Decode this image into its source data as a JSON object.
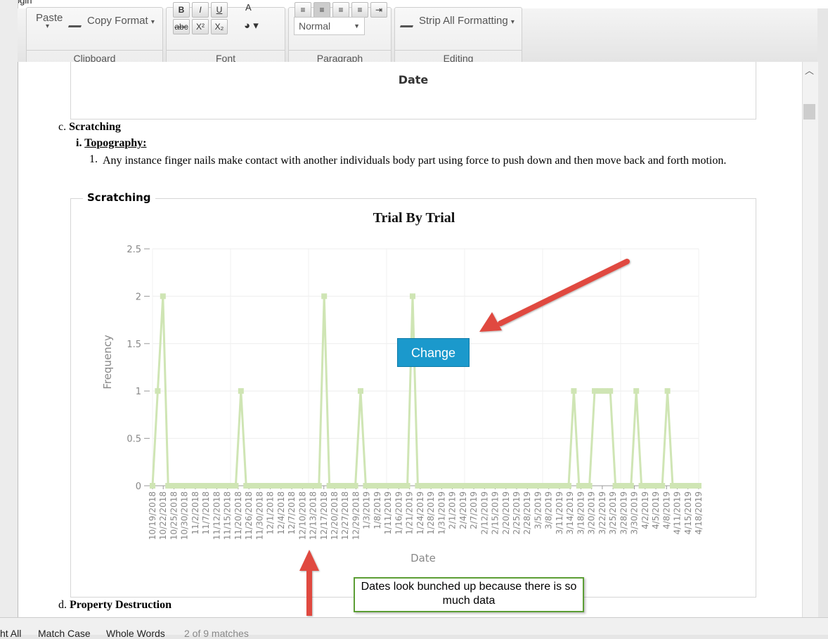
{
  "top": {
    "text": "ıl, Login"
  },
  "ribbon": {
    "groups": [
      {
        "label": "Clipboard"
      },
      {
        "label": "Font"
      },
      {
        "label": "Paragraph"
      },
      {
        "label": "Editing"
      }
    ],
    "paste_label": "Paste",
    "copy_format_label": "Copy Format",
    "paragraph_style": "Normal",
    "strip_formatting_label": "Strip All Formatting",
    "font_buttons": [
      "B",
      "I",
      "U",
      "abc",
      "X²",
      "X₂"
    ]
  },
  "doc": {
    "top_chart_xlabel": "Date",
    "section_c_marker": "c.",
    "section_c_title": "Scratching",
    "sub_i_marker": "i.",
    "sub_i_title": "Topography:",
    "item_1_marker": "1.",
    "item_1_text": "Any instance finger nails make contact with another individuals body part using force to push down and then move back and forth motion.",
    "chart_frame_label": "Scratching",
    "section_d_marker": "d.",
    "section_d_title": "Property Destruction"
  },
  "chart_data": {
    "type": "line",
    "title": "Trial By Trial",
    "xlabel": "Date",
    "ylabel": "Frequency",
    "ylim": [
      0,
      2.5
    ],
    "yticks": [
      0,
      0.5,
      1,
      1.5,
      2,
      2.5
    ],
    "xtick_labels": [
      "10/19/2018",
      "10/22/2018",
      "10/25/2018",
      "10/30/2018",
      "11/2/2018",
      "11/7/2018",
      "11/12/2018",
      "11/15/2018",
      "11/20/2018",
      "11/26/2018",
      "11/30/2018",
      "12/1/2018",
      "12/4/2018",
      "12/7/2018",
      "12/10/2018",
      "12/13/2018",
      "12/17/2018",
      "12/20/2018",
      "12/27/2018",
      "12/29/2018",
      "1/3/2019",
      "1/8/2019",
      "1/11/2019",
      "1/16/2019",
      "1/21/2019",
      "1/24/2019",
      "1/28/2019",
      "1/31/2019",
      "2/1/2019",
      "2/4/2019",
      "2/7/2019",
      "2/12/2019",
      "2/15/2019",
      "2/20/2019",
      "2/25/2019",
      "2/28/2019",
      "3/5/2019",
      "3/8/2019",
      "3/11/2019",
      "3/14/2019",
      "3/18/2019",
      "3/20/2019",
      "3/22/2019",
      "3/25/2019",
      "3/28/2019",
      "3/30/2019",
      "4/2/2019",
      "4/5/2019",
      "4/8/2019",
      "4/11/2019",
      "4/15/2019",
      "4/18/2019"
    ],
    "series": [
      {
        "values": [
          0,
          1,
          2,
          0,
          0,
          0,
          0,
          0,
          0,
          0,
          0,
          0,
          0,
          0,
          0,
          0,
          0,
          1,
          0,
          0,
          0,
          0,
          0,
          0,
          0,
          0,
          0,
          0,
          0,
          0,
          0,
          0,
          0,
          2,
          0,
          0,
          0,
          0,
          0,
          0,
          1,
          0,
          0,
          0,
          0,
          0,
          0,
          0,
          0,
          0,
          2,
          0,
          0,
          0,
          0,
          0,
          0,
          0,
          0,
          0,
          0,
          0,
          0,
          0,
          0,
          0,
          0,
          0,
          0,
          0,
          0,
          0,
          0,
          0,
          0,
          0,
          0,
          0,
          0,
          0,
          0,
          1,
          0,
          0,
          0,
          1,
          1,
          1,
          1,
          0,
          0,
          0,
          0,
          1,
          0,
          0,
          0,
          0,
          0,
          1,
          0,
          0,
          0,
          0,
          0,
          0
        ]
      }
    ],
    "color": "#cfe5b4",
    "grid": true
  },
  "annotations": {
    "change_button": "Change",
    "note": "Dates look bunched up because there is so much data",
    "arrow_color": "#e04a3f"
  },
  "findbar": {
    "highlight_all": "ht All",
    "match_case": "Match Case",
    "whole_words": "Whole Words",
    "matches": "2 of 9 matches"
  }
}
